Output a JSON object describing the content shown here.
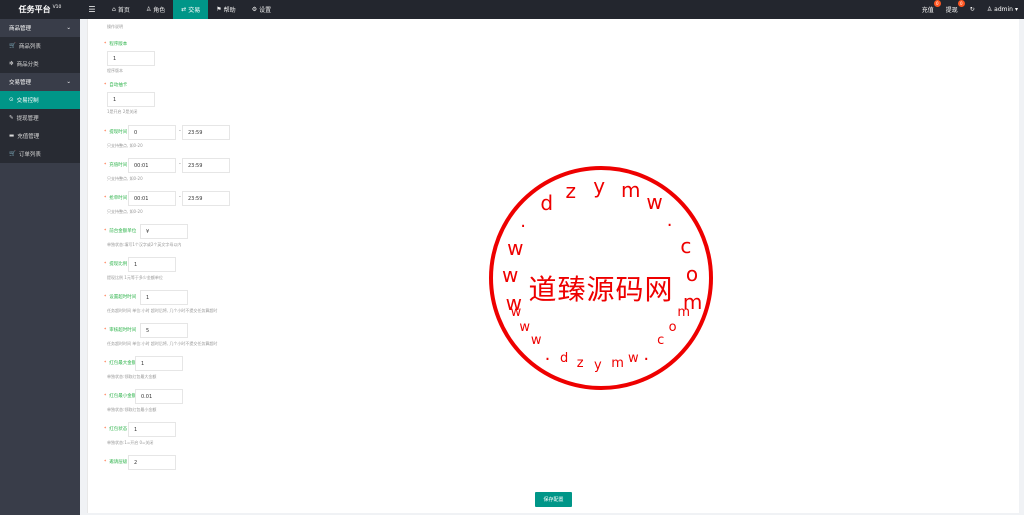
{
  "header": {
    "title": "任务平台",
    "version": "V10",
    "menu_icon": "☰",
    "nav": [
      {
        "icon": "⌂",
        "label": "首页"
      },
      {
        "icon": "♙",
        "label": "角色"
      },
      {
        "icon": "⇄",
        "label": "交易"
      },
      {
        "icon": "⚑",
        "label": "帮助"
      },
      {
        "icon": "⚙",
        "label": "设置"
      }
    ],
    "right": [
      {
        "label": "充值",
        "badge": "0"
      },
      {
        "label": "提现",
        "badge": "0"
      }
    ],
    "refresh_icon": "↻",
    "user": "admin",
    "user_caret": "▾",
    "user_icon": "♙"
  },
  "sidebar": {
    "groups": [
      {
        "label": "商品管理",
        "arrow": "⌄",
        "items": [
          {
            "icon": "🛒",
            "label": "商品列表"
          },
          {
            "icon": "✻",
            "label": "商品分类"
          }
        ]
      },
      {
        "label": "交易管理",
        "arrow": "⌄",
        "items": [
          {
            "icon": "⊙",
            "label": "交易控制"
          },
          {
            "icon": "✎",
            "label": "提现管理"
          },
          {
            "icon": "▬",
            "label": "充值管理"
          },
          {
            "icon": "🛒",
            "label": "订单列表"
          }
        ]
      }
    ]
  },
  "form": {
    "top_hint": "操作说明",
    "fields": [
      {
        "label": "程序版本",
        "value": "1",
        "hint": "程序版本"
      },
      {
        "label": "自动抽卡",
        "value": "1",
        "hint": "1是开启 2是关闭"
      },
      {
        "label": "提现时间",
        "value": "0",
        "value2": "23:59",
        "hint": "只支持整点, 如0-20"
      },
      {
        "label": "充值时间",
        "value": "00:01",
        "value2": "23:59",
        "hint": "只支持整点, 如0-20"
      },
      {
        "label": "抢单时间",
        "value": "00:01",
        "value2": "23:59",
        "hint": "只支持整点, 如0-20"
      },
      {
        "label": "前台金额单位",
        "value": "¥",
        "hint": "单独状态:填写1个汉字或2个英文字母以内"
      },
      {
        "label": "提现比例",
        "value": "1",
        "hint": "提现比例 1元等于多少金额单位"
      },
      {
        "label": "设置超时时间",
        "value": "1",
        "hint": "任务超时时间 单位:小时 超时后将, 几个小时不提交任务算超时"
      },
      {
        "label": "审核超时时间",
        "value": "5",
        "hint": "任务超时时间 单位:小时 超时后将, 几个小时不提交任务算超时"
      },
      {
        "label": "红包最大金额",
        "value": "1",
        "hint": "单独状态:领取红包最大金额"
      },
      {
        "label": "红包最小金额",
        "value": "0.01",
        "hint": "单独状态:领取红包最小金额"
      },
      {
        "label": "红包状态",
        "value": "1",
        "hint": "单独状态:1=开启 0=关闭"
      },
      {
        "label": "邀请层级",
        "value": "2",
        "hint": ""
      }
    ],
    "save_label": "保存配置"
  },
  "stamp": {
    "center_text": "道臻源码网",
    "upper_ring": "www.dzymw.com",
    "lower_ring": "www.dzymw.com",
    "color": "#e00000"
  }
}
